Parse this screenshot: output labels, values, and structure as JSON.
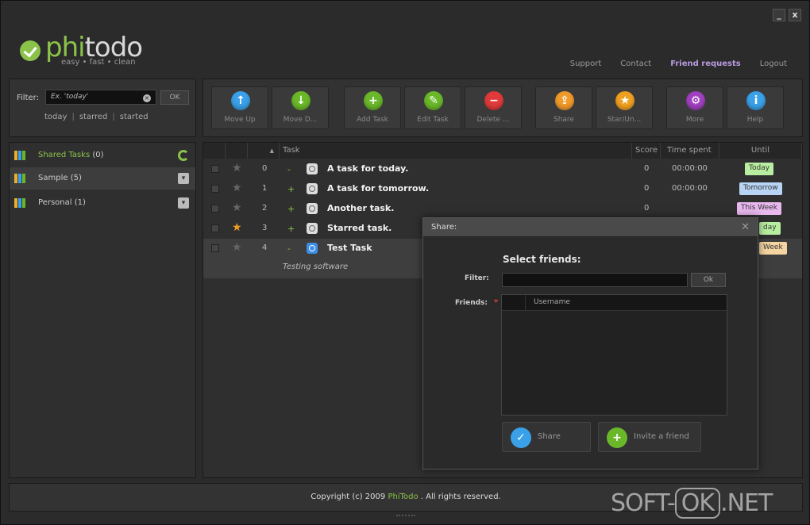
{
  "window": {
    "minimize": "_",
    "close": "x"
  },
  "logo": {
    "phi": "phi",
    "todo": "todo",
    "tagline": "easy • fast • clean"
  },
  "nav": {
    "support": "Support",
    "contact": "Contact",
    "friend_requests": "Friend requests",
    "logout": "Logout"
  },
  "filter": {
    "label": "Filter:",
    "placeholder": "Ex. 'today'",
    "ok": "OK",
    "links": [
      "today",
      "starred",
      "started"
    ]
  },
  "toolbar": [
    {
      "label": "Move Up",
      "icon": "arrow-up-icon",
      "color": "#3aa0e8",
      "glyph": "↑"
    },
    {
      "label": "Move D...",
      "icon": "arrow-down-icon",
      "color": "#6ab82a",
      "glyph": "↓"
    },
    {
      "label": "Add Task",
      "icon": "plus-icon",
      "color": "#6ab82a",
      "glyph": "+"
    },
    {
      "label": "Edit Task",
      "icon": "pencil-icon",
      "color": "#6ab82a",
      "glyph": "✎"
    },
    {
      "label": "Delete ...",
      "icon": "minus-icon",
      "color": "#e03a3a",
      "glyph": "−"
    },
    {
      "label": "Share",
      "icon": "share-icon",
      "color": "#f09a2a",
      "glyph": "⇪"
    },
    {
      "label": "Star/Un...",
      "icon": "star-icon",
      "color": "#f0a020",
      "glyph": "★"
    },
    {
      "label": "More",
      "icon": "gear-icon",
      "color": "#a040c0",
      "glyph": "⚙"
    },
    {
      "label": "Help",
      "icon": "info-icon",
      "color": "#3aa0e8",
      "glyph": "i"
    }
  ],
  "sidebar": [
    {
      "label": "Shared Tasks",
      "count": "(0)"
    },
    {
      "label": "Sample",
      "count": "(5)"
    },
    {
      "label": "Personal",
      "count": "(1)"
    }
  ],
  "table": {
    "headers": {
      "sort": "▲",
      "task": "Task",
      "score": "Score",
      "time": "Time spent",
      "until": "Until"
    },
    "rows": [
      {
        "index": "0",
        "expander": "-",
        "name": "A task for today.",
        "score": "0",
        "time": "00:00:00",
        "until": "Today",
        "until_color": "#b8eea0"
      },
      {
        "index": "1",
        "expander": "+",
        "name": "A task for tomorrow.",
        "score": "0",
        "time": "00:00:00",
        "until": "Tomorrow",
        "until_color": "#b8d4f4"
      },
      {
        "index": "2",
        "expander": "+",
        "name": "Another task.",
        "score": "0",
        "time": "",
        "until": "This Week",
        "until_color": "#e8b8ee"
      },
      {
        "index": "3",
        "expander": "+",
        "name": "Starred task.",
        "score": "",
        "time": "",
        "until": "day",
        "until_color": "#b8eea0"
      },
      {
        "index": "4",
        "expander": "-",
        "name": "Test Task",
        "score": "",
        "time": "",
        "until": "Week",
        "until_color": "#f4d4a0",
        "note": "Testing software"
      }
    ]
  },
  "footer": {
    "prefix": "Copyright (c) 2009",
    "brand": "PhiTodo",
    "suffix": ". All rights reserved."
  },
  "dialog": {
    "title": "Share:",
    "close": "✕",
    "heading": "Select friends:",
    "filter_label": "Filter:",
    "ok": "Ok",
    "friends_label": "Friends:",
    "required": "*",
    "column": "Username",
    "share_button": "Share",
    "invite_button": "Invite a friend"
  },
  "watermark": {
    "left": "SOFT-",
    "box": "OK",
    "right": ".NET"
  }
}
